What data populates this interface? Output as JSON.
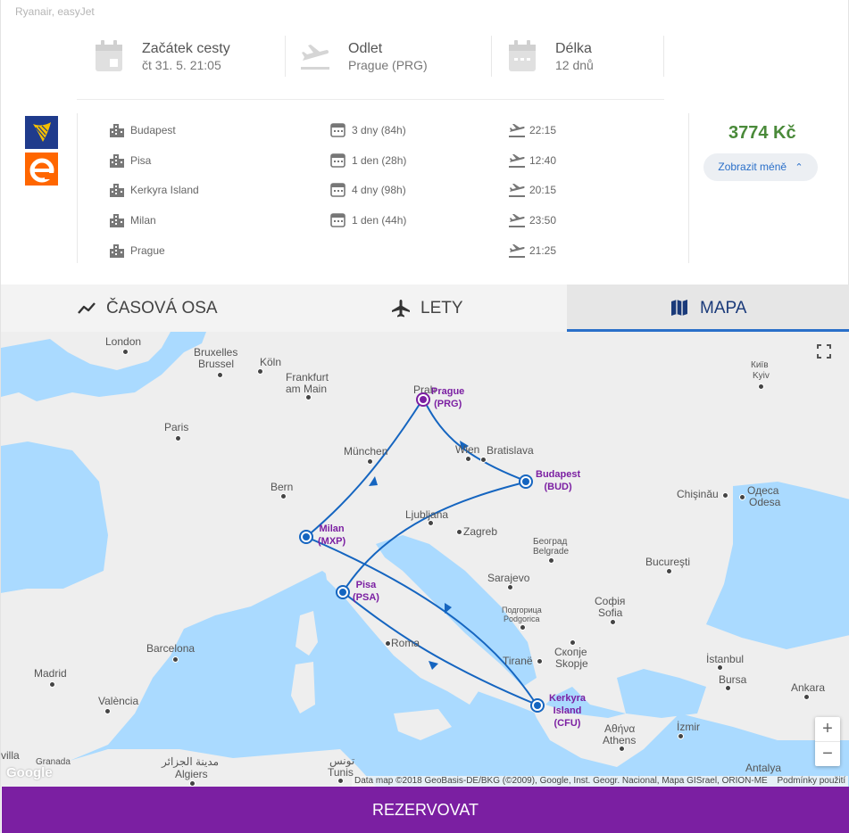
{
  "carriers": "Ryanair, easyJet",
  "summary": {
    "start": {
      "label": "Začátek cesty",
      "value": "čt 31. 5. 21:05"
    },
    "departure": {
      "label": "Odlet",
      "value": "Prague (PRG)"
    },
    "duration": {
      "label": "Délka",
      "value": "12 dnů"
    }
  },
  "itinerary": [
    {
      "city": "Budapest",
      "stay": "3 dny (84h)",
      "time": "22:15"
    },
    {
      "city": "Pisa",
      "stay": "1 den (28h)",
      "time": "12:40"
    },
    {
      "city": "Kerkyra Island",
      "stay": "4 dny (98h)",
      "time": "20:15"
    },
    {
      "city": "Milan",
      "stay": "1 den (44h)",
      "time": "23:50"
    },
    {
      "city": "Prague",
      "stay": "",
      "time": "21:25"
    }
  ],
  "price": "3774 Kč",
  "show_less": "Zobrazit méně",
  "tabs": {
    "timeline": "ČASOVÁ OSA",
    "flights": "LETY",
    "map": "MAPA"
  },
  "map": {
    "cities": [
      "London",
      "Bruxelles",
      "Brussel",
      "Köln",
      "Frankfurt",
      "am Main",
      "Paris",
      "München",
      "Bern",
      "Wien",
      "Bratislava",
      "Ljubljana",
      "Zagreb",
      "Београд",
      "Belgrade",
      "Sarajevo",
      "Bucureşti",
      "Chişinău",
      "Одеса",
      "Odesa",
      "Київ",
      "Kyiv",
      "Подгорица",
      "Podgorica",
      "Софія",
      "Sofia",
      "Скопје",
      "Skopje",
      "Tiranë",
      "Roma",
      "Barcelona",
      "Madrid",
      "València",
      "İstanbul",
      "Bursa",
      "Ankara",
      "Αθήνα",
      "Athens",
      "İzmir",
      "Antalya",
      "Granada",
      "Algiers",
      "مدينة الجزائر",
      "تونس",
      "Tunis",
      "villa",
      "Prah"
    ],
    "places": [
      {
        "name": "Prague",
        "code": "(PRG)"
      },
      {
        "name": "Budapest",
        "code": "(BUD)"
      },
      {
        "name": "Milan",
        "code": "(MXP)"
      },
      {
        "name": "Pisa",
        "code": "(PSA)"
      },
      {
        "name": "Kerkyra",
        "name2": "Island",
        "code": "(CFU)"
      }
    ],
    "attribution": "Data map ©2018 GeoBasis-DE/BKG (©2009), Google, Inst. Geogr. Nacional, Mapa GISrael, ORION-ME",
    "terms": "Podmínky použití",
    "google": "Google",
    "zoom_in": "+",
    "zoom_out": "−"
  },
  "book_button": "REZERVOVAT"
}
